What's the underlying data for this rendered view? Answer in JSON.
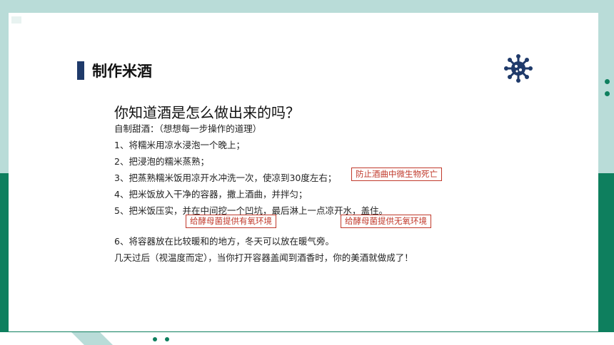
{
  "title": "制作米酒",
  "question": "你知道酒是怎么做出来的吗？",
  "subtitle": "自制甜酒：（想想每一步操作的道理）",
  "steps": [
    "1、将糯米用凉水浸泡一个晚上；",
    "2、把浸泡的糯米蒸熟；",
    "3、把蒸熟糯米饭用凉开水冲洗一次，使凉到30度左右；",
    "4、把米饭放入干净的容器，撒上酒曲，并拌匀；",
    "5、把米饭压实，并在中间挖一个凹坑，最后淋上一点凉开水，盖住。",
    "6、将容器放在比较暖和的地方，冬天可以放在暖气旁。"
  ],
  "conclusion": "几天过后（视温度而定），当你打开容器盖闻到酒香时，你的美酒就做成了！",
  "notes": {
    "step3": "防止酒曲中微生物死亡",
    "aerobic": "给酵母菌提供有氧环境",
    "anaerobic": "给酵母菌提供无氧环境"
  },
  "colors": {
    "accent_green": "#0e7f5e",
    "background_teal": "#b9dcd8",
    "title_bar_navy": "#1f3a6a",
    "note_red": "#c0392b"
  },
  "icons": [
    "virus-icon"
  ]
}
